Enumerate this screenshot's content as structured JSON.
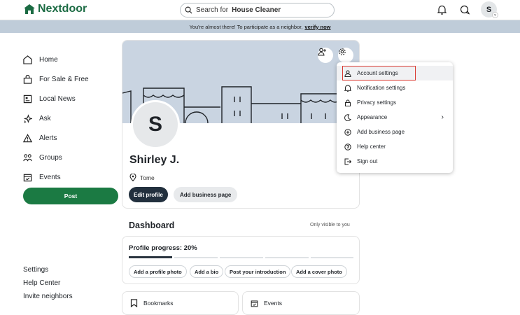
{
  "app": {
    "name": "Nextdoor",
    "brand_color": "#1b7a43"
  },
  "topbar": {
    "search_prefix": "Search for",
    "search_term": "House Cleaner",
    "icons": [
      "bell-icon",
      "chat-icon"
    ],
    "avatar_letter": "S"
  },
  "banner": {
    "text": "You're almost there! To participate as a neighbor,",
    "link": "verify now"
  },
  "sidebar": {
    "items": [
      {
        "label": "Home",
        "icon": "home-icon"
      },
      {
        "label": "For Sale & Free",
        "icon": "bag-icon"
      },
      {
        "label": "Local News",
        "icon": "news-icon"
      },
      {
        "label": "Ask",
        "icon": "sparkle-icon"
      },
      {
        "label": "Alerts",
        "icon": "alert-icon"
      },
      {
        "label": "Groups",
        "icon": "groups-icon"
      },
      {
        "label": "Events",
        "icon": "calendar-icon"
      }
    ],
    "post_label": "Post",
    "footer": [
      "Settings",
      "Help Center",
      "Invite neighbors"
    ]
  },
  "profile": {
    "avatar_letter": "S",
    "name": "Shirley J.",
    "location": "Tome",
    "edit_label": "Edit profile",
    "add_business_label": "Add business page"
  },
  "dashboard": {
    "title": "Dashboard",
    "visibility": "Only visible to you",
    "progress_title": "Profile progress: 20%",
    "progress_fraction": 0.2,
    "chips": [
      "Add a profile photo",
      "Add a bio",
      "Post your introduction",
      "Add a cover photo"
    ],
    "bookmarks_label": "Bookmarks",
    "events_label": "Events"
  },
  "menu": {
    "items": [
      {
        "label": "Account settings",
        "icon": "person-icon"
      },
      {
        "label": "Notification settings",
        "icon": "bell-icon"
      },
      {
        "label": "Privacy settings",
        "icon": "lock-icon"
      },
      {
        "label": "Appearance",
        "icon": "moon-icon"
      },
      {
        "label": "Add business page",
        "icon": "plus-circle-icon"
      },
      {
        "label": "Help center",
        "icon": "help-icon"
      },
      {
        "label": "Sign out",
        "icon": "signout-icon"
      }
    ]
  }
}
